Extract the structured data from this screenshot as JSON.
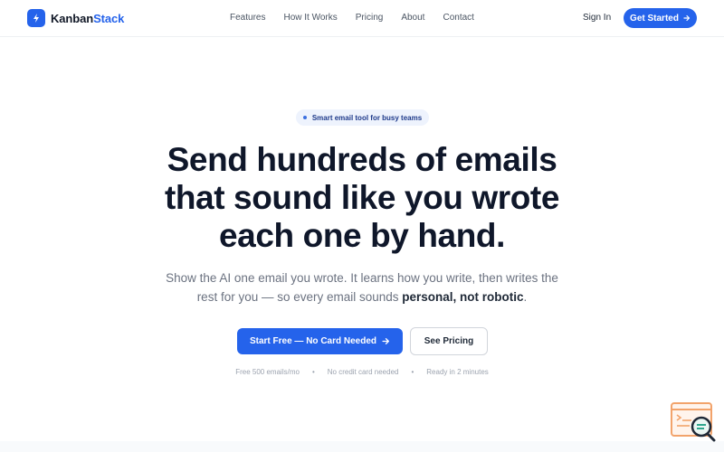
{
  "header": {
    "brand_prefix": "Kanban",
    "brand_suffix": "Stack",
    "nav": [
      "Features",
      "How It Works",
      "Pricing",
      "About",
      "Contact"
    ],
    "sign_in": "Sign In",
    "get_started": "Get Started"
  },
  "hero": {
    "badge": "Smart email tool for busy teams",
    "headline_line1": "Send hundreds of emails",
    "headline_line2": "that sound like you wrote",
    "headline_line3": "each one by hand.",
    "sub_text": "Show the AI one email you wrote. It learns how you write, then writes the rest for you — so every email sounds ",
    "sub_bold": "personal, not robotic",
    "sub_end": ".",
    "primary_cta": "Start Free — No Card Needed",
    "secondary_cta": "See Pricing",
    "meta": [
      "Free 500 emails/mo",
      "No credit card needed",
      "Ready in 2 minutes"
    ],
    "meta_separator": "•"
  },
  "colors": {
    "accent": "#2563eb",
    "heading": "#0f172a",
    "muted": "#6b7280"
  },
  "icons": {
    "brand": "lightning-bolt-icon",
    "arrow": "arrow-right-icon",
    "badge_dot": "dot-icon",
    "corner_widget": "search-document-icon"
  }
}
